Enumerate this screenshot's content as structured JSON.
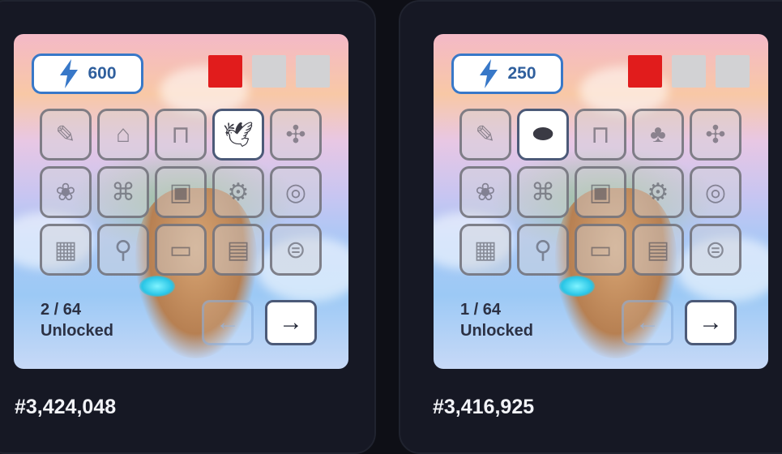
{
  "colors": {
    "page_bg": "#0e0f16",
    "card_bg": "#161824",
    "accent_blue": "#3878c8",
    "swatch_red": "#e11c1c",
    "swatch_gray": "#d2d2d4"
  },
  "cards": [
    {
      "energy": {
        "icon": "lightning-icon",
        "value": "600"
      },
      "swatches": [
        "#e11c1c",
        "#d2d2d4",
        "#d2d2d4"
      ],
      "grid": [
        {
          "icon": "sketch-icon",
          "glyph": "✎",
          "active": false
        },
        {
          "icon": "village-icon",
          "glyph": "⌂",
          "active": false
        },
        {
          "icon": "bench-icon",
          "glyph": "⊓",
          "active": false
        },
        {
          "icon": "pigeon-icon",
          "glyph": "🕊",
          "active": true
        },
        {
          "icon": "windmill-icon",
          "glyph": "✣",
          "active": false
        },
        {
          "icon": "plant-icon",
          "glyph": "❀",
          "active": false
        },
        {
          "icon": "gate-icon",
          "glyph": "⌘",
          "active": false
        },
        {
          "icon": "chest-icon",
          "glyph": "▣",
          "active": false
        },
        {
          "icon": "machine-icon",
          "glyph": "⚙",
          "active": false
        },
        {
          "icon": "pot-icon",
          "glyph": "◎",
          "active": false
        },
        {
          "icon": "crate-icon",
          "glyph": "▦",
          "active": false
        },
        {
          "icon": "swing-icon",
          "glyph": "⚲",
          "active": false
        },
        {
          "icon": "planter-icon",
          "glyph": "▭",
          "active": false
        },
        {
          "icon": "board-icon",
          "glyph": "▤",
          "active": false
        },
        {
          "icon": "trampoline-icon",
          "glyph": "⊜",
          "active": false
        }
      ],
      "unlocked_count": "2 / 64",
      "unlocked_label": "Unlocked",
      "prev_label": "←",
      "next_label": "→",
      "rank": "#3,424,048"
    },
    {
      "energy": {
        "icon": "lightning-icon",
        "value": "250"
      },
      "swatches": [
        "#e11c1c",
        "#d2d2d4",
        "#d2d2d4"
      ],
      "grid": [
        {
          "icon": "sketch-icon",
          "glyph": "✎",
          "active": false
        },
        {
          "icon": "platform-icon",
          "glyph": "⬬",
          "active": true
        },
        {
          "icon": "bench-icon",
          "glyph": "⊓",
          "active": false
        },
        {
          "icon": "tree-icon",
          "glyph": "♣",
          "active": false
        },
        {
          "icon": "windmill-icon",
          "glyph": "✣",
          "active": false
        },
        {
          "icon": "plant-icon",
          "glyph": "❀",
          "active": false
        },
        {
          "icon": "gate-icon",
          "glyph": "⌘",
          "active": false
        },
        {
          "icon": "chest-icon",
          "glyph": "▣",
          "active": false
        },
        {
          "icon": "machine-icon",
          "glyph": "⚙",
          "active": false
        },
        {
          "icon": "pot-icon",
          "glyph": "◎",
          "active": false
        },
        {
          "icon": "crate-icon",
          "glyph": "▦",
          "active": false
        },
        {
          "icon": "swing-icon",
          "glyph": "⚲",
          "active": false
        },
        {
          "icon": "planter-icon",
          "glyph": "▭",
          "active": false
        },
        {
          "icon": "board-icon",
          "glyph": "▤",
          "active": false
        },
        {
          "icon": "trampoline-icon",
          "glyph": "⊜",
          "active": false
        }
      ],
      "unlocked_count": "1 / 64",
      "unlocked_label": "Unlocked",
      "prev_label": "←",
      "next_label": "→",
      "rank": "#3,416,925"
    }
  ]
}
